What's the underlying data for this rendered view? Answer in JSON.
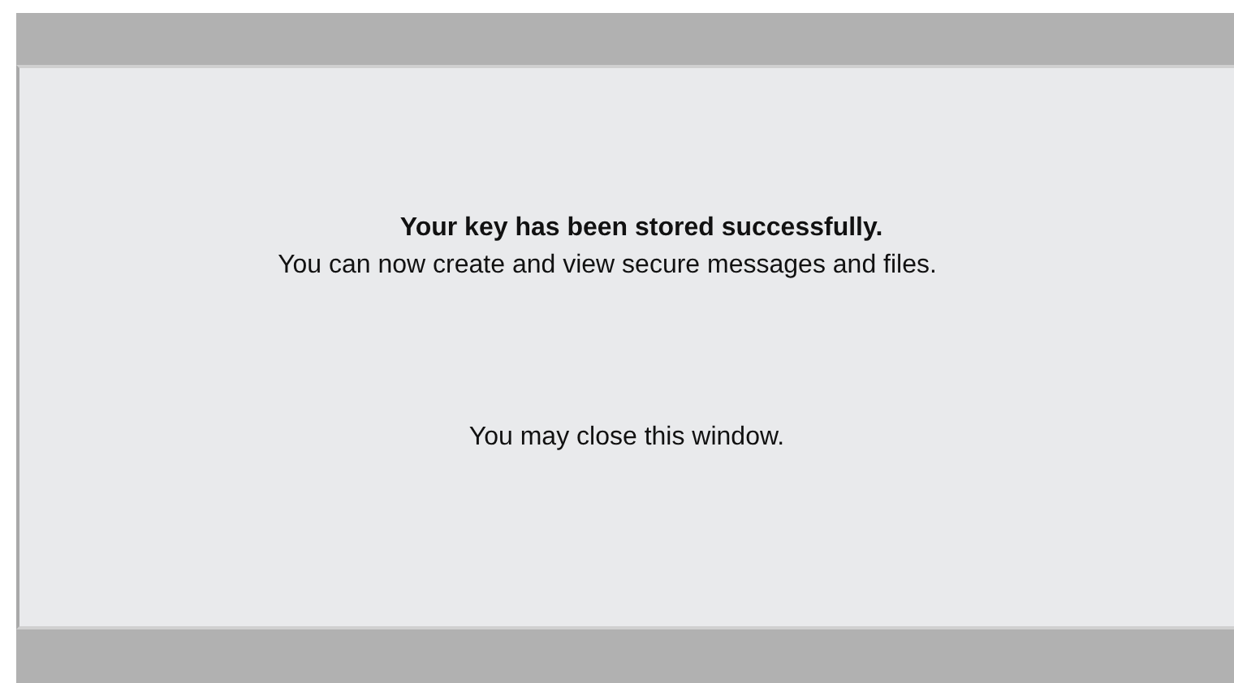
{
  "message": {
    "heading": "Your key has been stored successfully.",
    "detail": "You can now create and view secure messages and files.",
    "note": "You may close this window."
  }
}
